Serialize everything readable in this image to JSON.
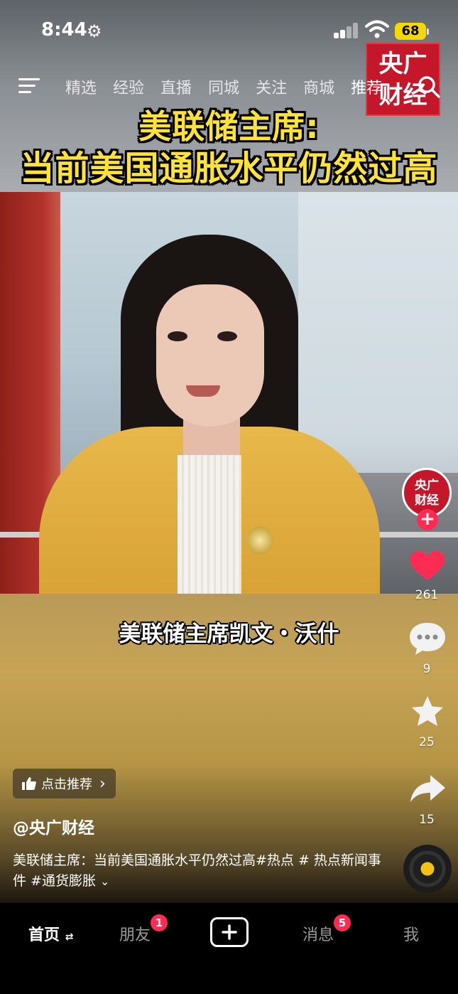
{
  "status_bar": {
    "time": "8:44",
    "battery": "68",
    "icons": [
      "settings-gear-icon",
      "signal-icon",
      "wifi-icon",
      "battery-icon"
    ]
  },
  "top_nav": {
    "tabs": [
      {
        "label": "精选",
        "active": false
      },
      {
        "label": "经验",
        "active": false
      },
      {
        "label": "直播",
        "active": false
      },
      {
        "label": "同城",
        "active": false
      },
      {
        "label": "关注",
        "active": false
      },
      {
        "label": "商城",
        "active": false
      },
      {
        "label": "推荐",
        "active": true
      }
    ],
    "icons": [
      "menu-icon",
      "search-icon"
    ]
  },
  "video": {
    "caption_line_1": "美联储主席:",
    "caption_line_2": "当前美国通胀水平仍然过高",
    "name_caption": "美联储主席凯文・沃什",
    "logo_text": "央广\n财经"
  },
  "actions": {
    "avatar_text": "央广\n财经",
    "follow": "+",
    "likes": "261",
    "comments": "9",
    "favorites": "25",
    "shares": "15",
    "colors": {
      "like": "#fe2c55",
      "badge": "#fe2c55"
    }
  },
  "info": {
    "recommend_chip": "点击推荐",
    "author": "@央广财经",
    "description": "美联储主席：当前美国通胀水平仍然过高#热点 # 热点新闻事件 #通货膨胀"
  },
  "tab_bar": {
    "home": "首页",
    "home_suffix": "⇄",
    "friends": "朋友",
    "friends_badge": "1",
    "create": "+",
    "messages": "消息",
    "messages_badge": "5",
    "me": "我"
  }
}
